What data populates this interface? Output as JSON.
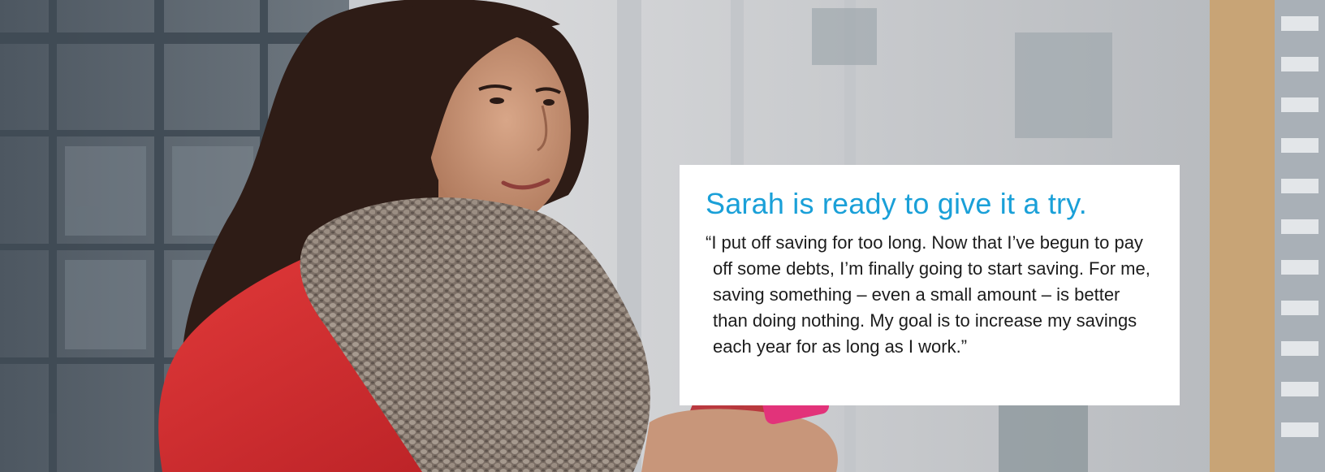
{
  "hero": {
    "image_description": "Woman in a red coat and knit scarf holding a phone, city buildings behind",
    "colors": {
      "title": "#1aa0d8",
      "body_text": "#1c1c1c",
      "card_background": "#ffffff",
      "coat": "#d42a2a",
      "scarf": "#8a7d72",
      "hair": "#2e1c16",
      "skin": "#c79577",
      "phone": "#e2337a"
    }
  },
  "quote": {
    "title": "Sarah is ready to give it a try.",
    "body": "“I put off saving for too long. Now that I’ve begun to pay off some debts, I’m finally going to start saving. For me, saving something – even a small amount – is better than doing nothing. My goal is to increase my savings each year for as long as I work.”"
  }
}
